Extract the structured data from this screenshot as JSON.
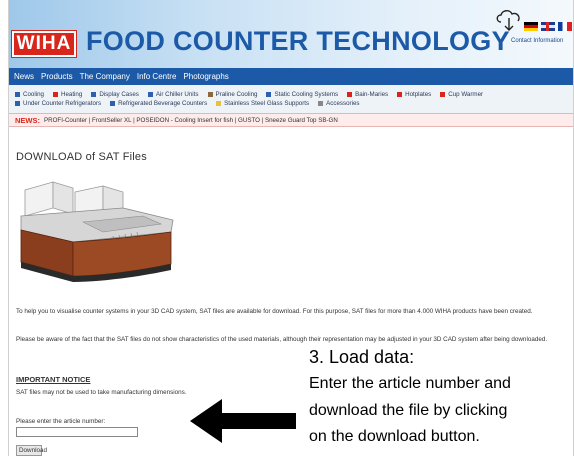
{
  "header": {
    "logo_text": "WIHA",
    "title": "FOOD COUNTER TECHNOLOGY",
    "contact_link": "Contact Information",
    "colors": {
      "brand_blue": "#1c5aa8",
      "brand_red": "#d9261c"
    }
  },
  "nav": {
    "items": [
      "News",
      "Products",
      "The Company",
      "Info Centre",
      "Photographs"
    ]
  },
  "categories": {
    "row1": [
      {
        "label": "Cooling",
        "color": "#2f5fb0"
      },
      {
        "label": "Heating",
        "color": "#d9261c"
      },
      {
        "label": "Display Cases",
        "color": "#2f5fb0"
      },
      {
        "label": "Air Chiller Units",
        "color": "#2f5fb0"
      },
      {
        "label": "Praline Cooling",
        "color": "#8a6a3a"
      },
      {
        "label": "Static Cooling Systems",
        "color": "#2f5fb0"
      },
      {
        "label": "Bain-Maries",
        "color": "#d9261c"
      },
      {
        "label": "Hotplates",
        "color": "#d9261c"
      },
      {
        "label": "Cup Warmer",
        "color": "#d9261c"
      }
    ],
    "row2": [
      {
        "label": "Under Counter Refrigerators",
        "color": "#2f5fb0"
      },
      {
        "label": "Refrigerated Beverage Counters",
        "color": "#2f5fb0"
      },
      {
        "label": "Stainless Steel Glass Supports",
        "color": "#e8c23a"
      },
      {
        "label": "Accessories",
        "color": "#888888"
      }
    ]
  },
  "news": {
    "label": "NEWS:",
    "items": "PROFI-Counter | FrontSeller XL | POSEIDON - Cooling Insert for fish | GUSTO | Sneeze Guard Top SB-GN"
  },
  "main": {
    "heading": "DOWNLOAD of SAT Files",
    "para1": "To help you to visualise counter systems in your 3D CAD system, SAT files are available for download. For this purpose, SAT files for more than 4.000 WIHA products have been created.",
    "para2": "Please be aware of the fact that the SAT files do not show characteristics of the used materials, although their representation may be adjusted in your 3D CAD system after being downloaded.",
    "notice_heading": "IMPORTANT NOTICE",
    "notice_text": "SAT files may not be used to take manufacturing dimensions.",
    "input_label": "Please enter the article number:",
    "input_value": "",
    "download_button": "Download"
  },
  "annotation": {
    "title": "3. Load data:",
    "line1": "Enter the article number and",
    "line2": "download the file by clicking",
    "line3": "on the download button."
  },
  "icons": [
    "cloud-download-icon",
    "flag-germany-icon",
    "flag-uk-icon",
    "flag-france-icon",
    "arrow-left-icon"
  ]
}
